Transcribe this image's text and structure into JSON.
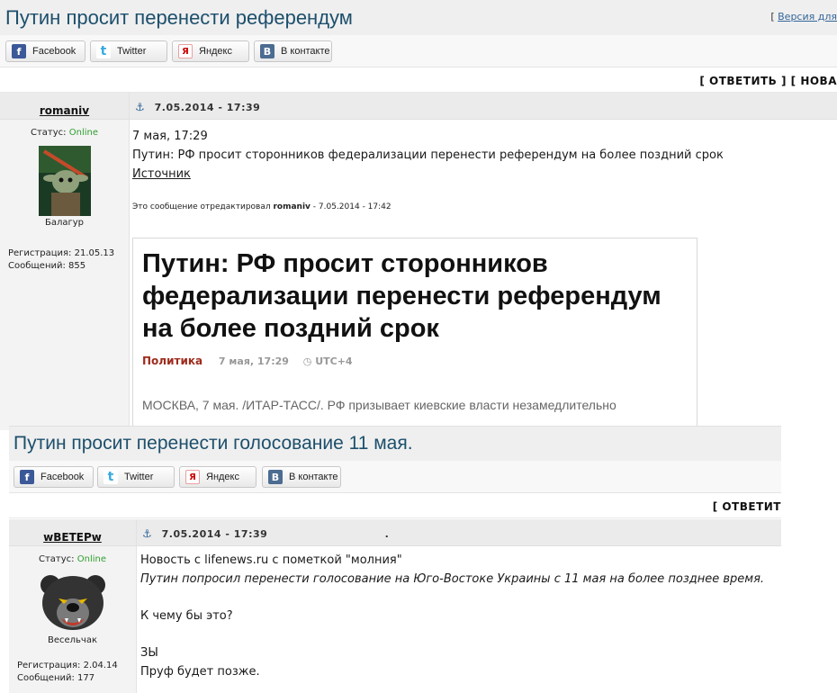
{
  "post1": {
    "topic_title": "Путин просит перенести референдум",
    "print_link": "Версия для",
    "share": {
      "facebook": "Facebook",
      "twitter": "Twitter",
      "yandex": "Яндекс",
      "vkontakte": "В контакте"
    },
    "reply_bar": "[ ОТВЕТИТЬ ] [ НОВА",
    "author": "romaniv",
    "date": "7.05.2014 - 17:39",
    "status_label": "Статус:",
    "status_value": "Online",
    "rank": "Балагур",
    "registration": "Регистрация: 21.05.13",
    "messages": "Сообщений: 855",
    "body_line1": "7 мая, 17:29",
    "body_line2": "Путин: РФ просит сторонников федерализации перенести референдум на более поздний срок",
    "source_link": "Источник",
    "edited_prefix": "Это сообщение отредактировал",
    "edited_user": "romaniv",
    "edited_date": "- 7.05.2014 - 17:42",
    "embed": {
      "title": "Путин: РФ просит сторонников федерализации перенести референдум на более поздний срок",
      "category": "Политика",
      "time": "7 мая, 17:29",
      "timezone": "UTC+4",
      "lead": "МОСКВА, 7 мая. /ИТАР-ТАСС/. РФ призывает киевские власти незамедлительно"
    }
  },
  "post2": {
    "topic_title": "Путин просит перенести голосование 11 мая.",
    "share": {
      "facebook": "Facebook",
      "twitter": "Twitter",
      "yandex": "Яндекс",
      "vkontakte": "В контакте"
    },
    "reply_bar": "[ ОТВЕТИТ",
    "author": "wВЕТЕРw",
    "date": "7.05.2014 - 17:39",
    "date_trailing": ".",
    "status_label": "Статус:",
    "status_value": "Online",
    "rank": "Весельчак",
    "registration": "Регистрация: 2.04.14",
    "messages": "Сообщений: 177",
    "body_line1": "Новость с lifenews.ru с пометкой \"молния\"",
    "body_line2": "Путин попросил перенести голосование на Юго-Востоке Украины с 11 мая на более позднее время.",
    "body_line3": "К чему бы это?",
    "body_line4": "ЗЫ",
    "body_line5": "Пруф будет позже."
  }
}
